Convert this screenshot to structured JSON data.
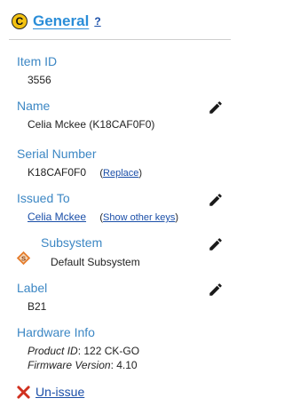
{
  "header": {
    "title": "General",
    "help": "?",
    "badge_letter": "C",
    "badge_icon": "copyright-icon"
  },
  "fields": {
    "item_id": {
      "label": "Item ID",
      "value": "3556"
    },
    "name": {
      "label": "Name",
      "value": "Celia Mckee (K18CAF0F0)"
    },
    "serial": {
      "label": "Serial Number",
      "value": "K18CAF0F0",
      "paren_open": "(",
      "action": "Replace",
      "paren_close": ")"
    },
    "issued_to": {
      "label": "Issued To",
      "value": "Celia Mckee",
      "paren_open": "(",
      "action": "Show other keys",
      "paren_close": ")"
    },
    "subsystem": {
      "label": "Subsystem",
      "value": "Default Subsystem",
      "badge_letter": "S",
      "icon": "subsystem-icon"
    },
    "label": {
      "label": "Label",
      "value": "B21"
    },
    "hardware": {
      "label": "Hardware Info",
      "product_key": "Product ID",
      "product_value": ": 122 CK-GO",
      "firmware_key": "Firmware Version",
      "firmware_value": ": 4.10"
    }
  },
  "actions": {
    "unissue": "Un-issue",
    "edit_icon": "pencil-icon",
    "unissue_icon": "red-x-icon"
  },
  "colors": {
    "label": "#3c87c4",
    "link": "#1b4fa8",
    "title": "#2a8dd8",
    "badge": "#f3c212",
    "danger": "#d0301f"
  }
}
